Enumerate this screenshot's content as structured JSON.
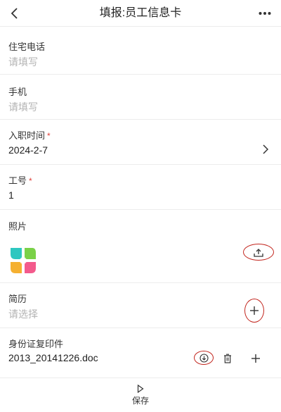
{
  "header": {
    "title": "填报:员工信息卡"
  },
  "fields": {
    "home_phone": {
      "label": "住宅电话",
      "placeholder": "请填写"
    },
    "mobile": {
      "label": "手机",
      "placeholder": "请填写"
    },
    "hire_date": {
      "label": "入职时间",
      "required_mark": "*",
      "value": "2024-2-7"
    },
    "employee_no": {
      "label": "工号",
      "required_mark": "*",
      "value": "1"
    },
    "photo": {
      "label": "照片"
    },
    "resume": {
      "label": "简历",
      "placeholder": "请选择"
    },
    "id_copy": {
      "label": "身份证复印件",
      "file_name": "2013_20141226.doc"
    }
  },
  "footer": {
    "save_label": "保存"
  },
  "colors": {
    "required": "#e0403a",
    "annotation": "#c2251d",
    "placeholder": "#b3b3b3"
  }
}
